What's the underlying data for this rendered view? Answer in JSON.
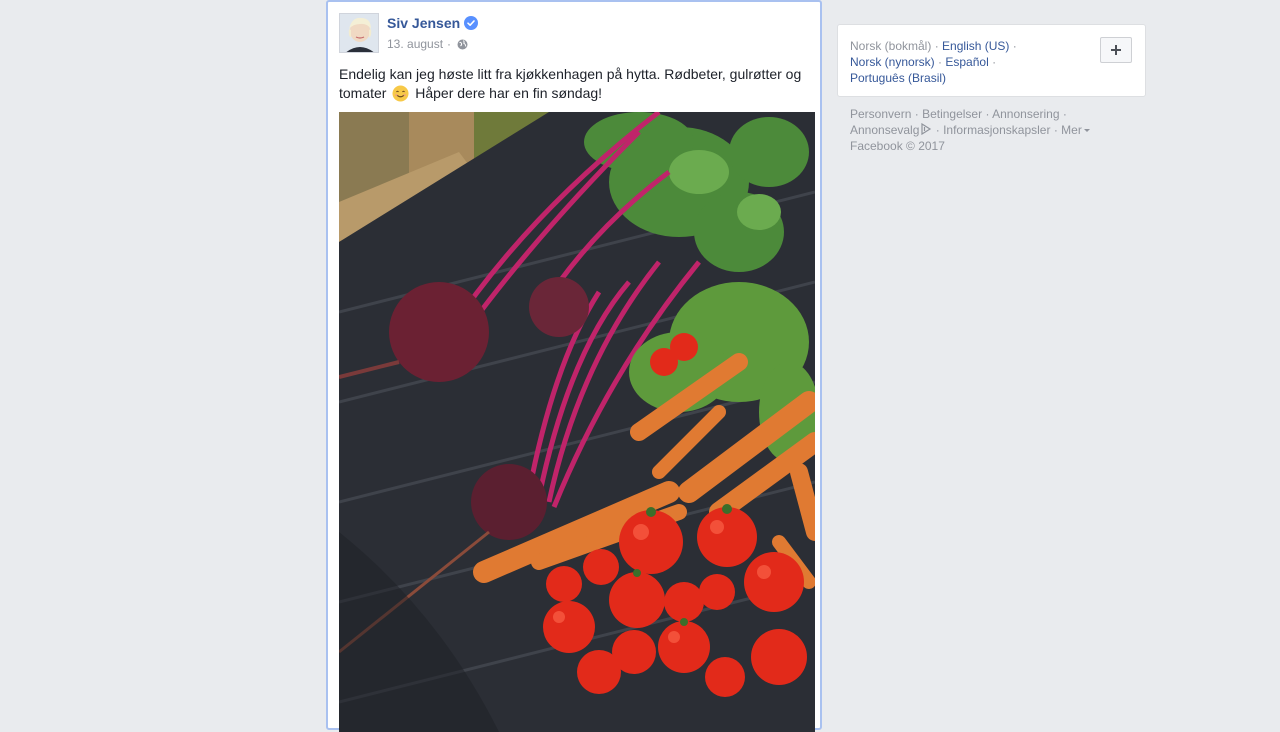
{
  "post": {
    "author": "Siv Jensen",
    "date": "13. august",
    "date_separator": "·",
    "text_part1": "Endelig kan jeg høste litt fra kjøkkenhagen på hytta. Rødbeter, gulrøtter og tomater",
    "text_part2": "Håper dere har en fin søndag!",
    "icons": {
      "verified": "verified-badge-icon",
      "audience": "globe-icon",
      "emoji": "smiling-face-emoji"
    }
  },
  "languages": {
    "current": "Norsk (bokmål)",
    "options": [
      "English (US)",
      "Norsk (nynorsk)",
      "Español",
      "Português (Brasil)"
    ],
    "separator": "·",
    "add_icon": "plus-icon"
  },
  "footer": {
    "links": [
      "Personvern",
      "Betingelser",
      "Annonsering",
      "Annonsevalg",
      "Informasjonskapsler",
      "Mer"
    ],
    "separator": "·",
    "copyright": "Facebook © 2017"
  },
  "colors": {
    "link": "#365899",
    "muted": "#90949c",
    "background": "#e9ebee",
    "focus_border": "#a9c1f0"
  }
}
